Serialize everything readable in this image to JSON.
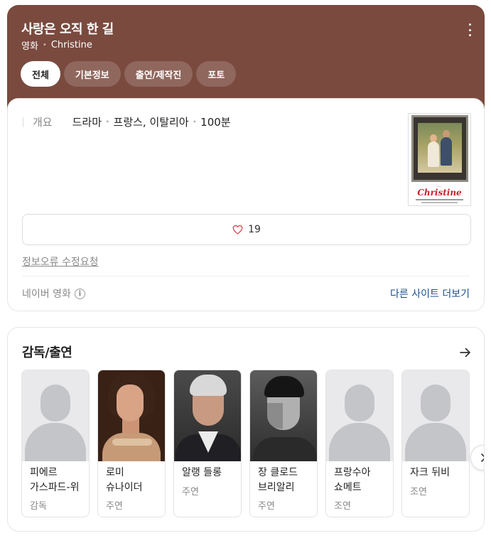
{
  "header": {
    "title": "사랑은 오직 한 길",
    "category": "영화",
    "original_title": "Christine",
    "more_icon": "more-vertical-icon",
    "background_color": "#7a4a3f"
  },
  "tabs": [
    {
      "label": "전체",
      "active": true
    },
    {
      "label": "기본정보",
      "active": false
    },
    {
      "label": "출연/제작진",
      "active": false
    },
    {
      "label": "포토",
      "active": false
    }
  ],
  "info": {
    "summary_label": "개요",
    "genre": "드라마",
    "country": "프랑스, 이탈리아",
    "runtime": "100분",
    "poster_title": "Christine",
    "like_count": "19",
    "like_icon": "heart-outline-icon",
    "report_link": "정보오류 수정요청",
    "source": "네이버 영화",
    "source_info_icon": "info-circle-icon",
    "other_sites": "다른 사이트 더보기",
    "link_color": "#1a4e8c"
  },
  "cast": {
    "title": "감독/출연",
    "arrow_icon": "arrow-right-icon",
    "people": [
      {
        "name": "피에르 가스파드-위",
        "role": "감독",
        "photo": "placeholder"
      },
      {
        "name": "로미 슈나이더",
        "role": "주연",
        "photo": "romy"
      },
      {
        "name": "알랭 들롱",
        "role": "주연",
        "photo": "delon"
      },
      {
        "name": "장 클로드 브리알리",
        "role": "주연",
        "photo": "brialy"
      },
      {
        "name": "프랑수아 쇼메트",
        "role": "조연",
        "photo": "placeholder"
      },
      {
        "name": "자크 뒤비",
        "role": "조연",
        "photo": "placeholder"
      }
    ],
    "next_icon": "chevron-right-icon"
  }
}
